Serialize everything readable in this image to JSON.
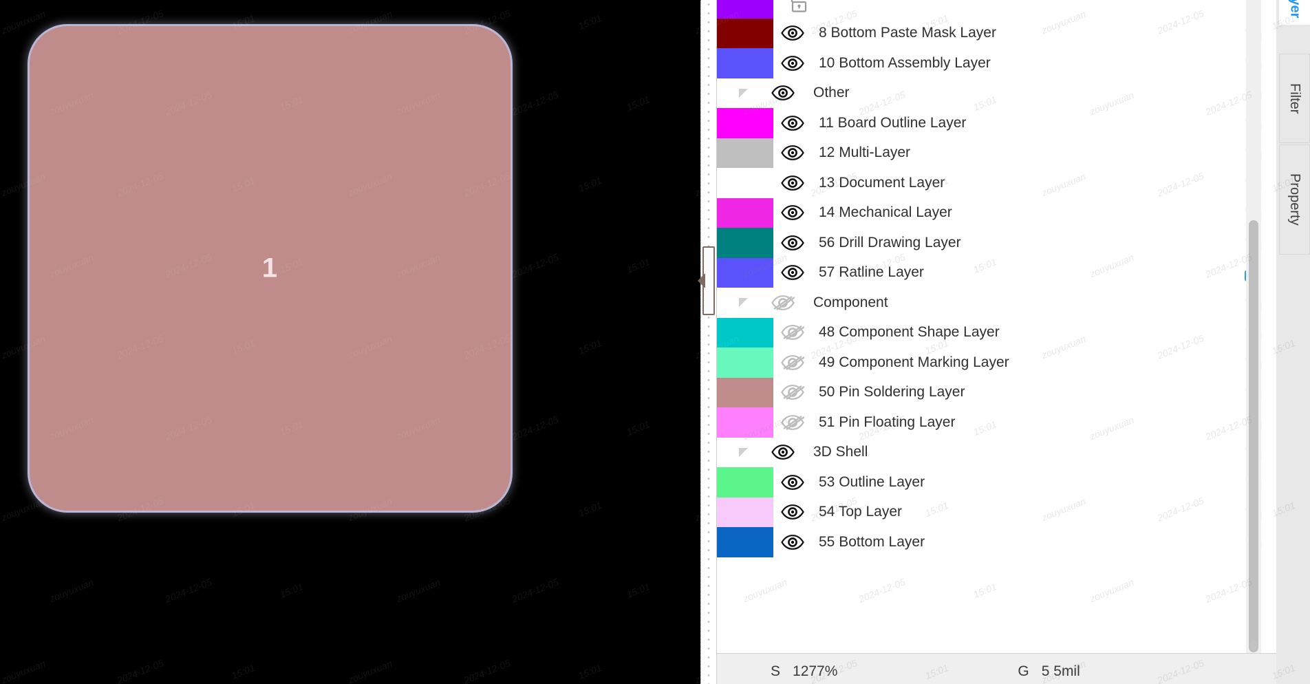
{
  "canvas": {
    "pad_label": "1",
    "background": "#000000",
    "pad_fill": "#c08b8b",
    "pad_border": "#b9b6d6"
  },
  "panel": {
    "rows": [
      {
        "type": "layer",
        "number": "",
        "name": "",
        "swatch": "#9e00ff",
        "visible": true,
        "locked": false,
        "partial": true
      },
      {
        "type": "layer",
        "number": "8",
        "name": "Bottom Paste Mask Layer",
        "swatch": "#800000",
        "visible": true,
        "locked": false
      },
      {
        "type": "layer",
        "number": "10",
        "name": "Bottom Assembly Layer",
        "swatch": "#5b52fb",
        "visible": true,
        "locked": false
      },
      {
        "type": "group",
        "number": "",
        "name": "Other",
        "swatch": null,
        "visible": true,
        "locked": false
      },
      {
        "type": "layer",
        "number": "11",
        "name": "Board Outline Layer",
        "swatch": "#ff00ff",
        "visible": true,
        "locked": false
      },
      {
        "type": "layer",
        "number": "12",
        "name": "Multi-Layer",
        "swatch": "#bfbfbf",
        "visible": true,
        "locked": false
      },
      {
        "type": "layer",
        "number": "13",
        "name": "Document Layer",
        "swatch": "#ffffff",
        "visible": true,
        "locked": false
      },
      {
        "type": "layer",
        "number": "14",
        "name": "Mechanical Layer",
        "swatch": "#ef26e4",
        "visible": true,
        "locked": false
      },
      {
        "type": "layer",
        "number": "56",
        "name": "Drill Drawing Layer",
        "swatch": "#00807f",
        "visible": true,
        "locked": false
      },
      {
        "type": "layer",
        "number": "57",
        "name": "Ratline Layer",
        "swatch": "#5b52fb",
        "visible": true,
        "locked": true,
        "highlighted": true
      },
      {
        "type": "group",
        "number": "",
        "name": "Component",
        "swatch": null,
        "visible": false,
        "locked": false
      },
      {
        "type": "layer",
        "number": "48",
        "name": "Component Shape Layer",
        "swatch": "#00c8c8",
        "visible": false,
        "locked": false
      },
      {
        "type": "layer",
        "number": "49",
        "name": "Component Marking Layer",
        "swatch": "#68f7bd",
        "visible": false,
        "locked": false
      },
      {
        "type": "layer",
        "number": "50",
        "name": "Pin Soldering Layer",
        "swatch": "#c08b8b",
        "visible": false,
        "locked": false
      },
      {
        "type": "layer",
        "number": "51",
        "name": "Pin Floating Layer",
        "swatch": "#ff80ff",
        "visible": false,
        "locked": false
      },
      {
        "type": "group",
        "number": "",
        "name": "3D Shell",
        "swatch": null,
        "visible": true,
        "locked": false
      },
      {
        "type": "layer",
        "number": "53",
        "name": "Outline Layer",
        "swatch": "#5cf58b",
        "visible": true,
        "locked": false
      },
      {
        "type": "layer",
        "number": "54",
        "name": "Top Layer",
        "swatch": "#f8c9fb",
        "visible": true,
        "locked": false
      },
      {
        "type": "layer",
        "number": "55",
        "name": "Bottom Layer",
        "swatch": "#0a66c2",
        "visible": true,
        "locked": false
      }
    ],
    "icons": {
      "visible": "eye-icon",
      "hidden": "eye-off-icon",
      "locked": "lock-closed-icon",
      "unlocked": "lock-open-icon",
      "group_toggle": "triangle-collapse-icon"
    },
    "annotation_color": "#f4503c",
    "lock_active_color": "#2196f3"
  },
  "statusbar": {
    "zoom_key": "S",
    "zoom_value": "1277%",
    "grid_key": "G",
    "grid_value": "5  5mil"
  },
  "tabs": [
    {
      "label": "Layer",
      "active": true
    },
    {
      "label": "Filter",
      "active": false
    },
    {
      "label": "Property",
      "active": false
    }
  ],
  "watermark_texts": [
    "zouyuxuan",
    "2024-12-05",
    "15:01"
  ]
}
